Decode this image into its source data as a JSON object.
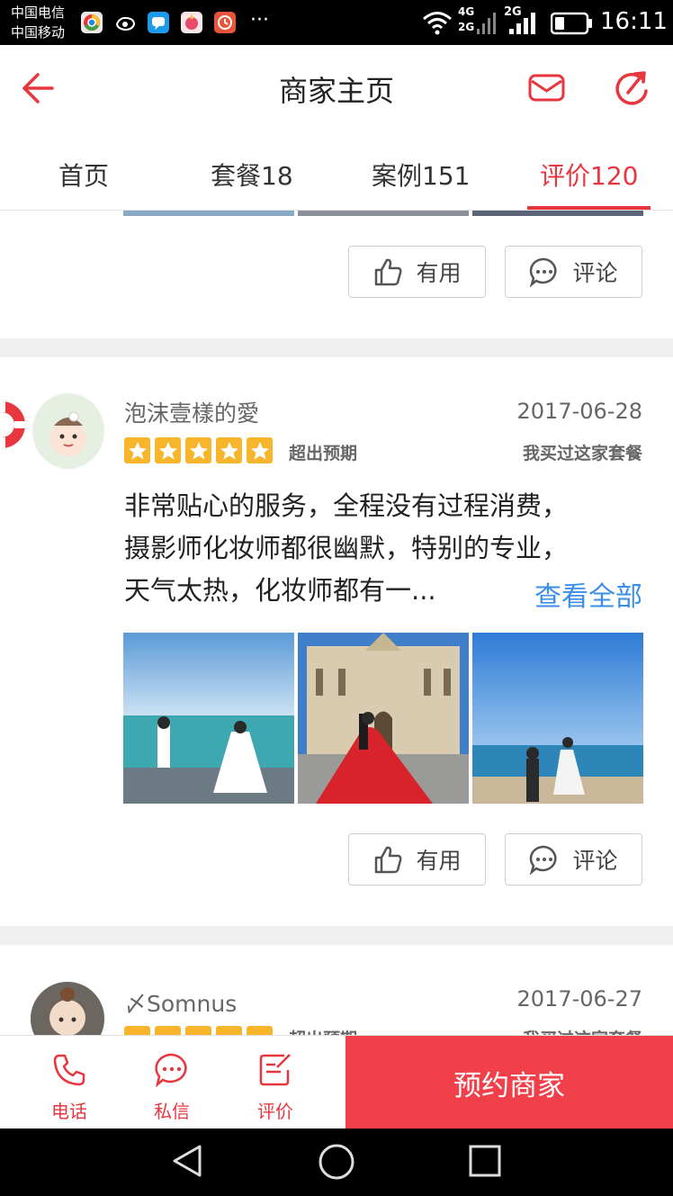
{
  "status_bar": {
    "carrier_1": "中国电信",
    "carrier_2": "中国移动",
    "overflow": "···",
    "net_1_top": "4G",
    "net_1_bottom": "2G",
    "net_2": "2G",
    "time": "16:11"
  },
  "header": {
    "title": "商家主页",
    "back_icon": "arrow-left-icon",
    "message_icon": "mail-icon",
    "share_icon": "share-icon"
  },
  "tabs": [
    {
      "label": "首页",
      "active": false
    },
    {
      "label": "套餐18",
      "active": false
    },
    {
      "label": "案例151",
      "active": false
    },
    {
      "label": "评价120",
      "active": true
    }
  ],
  "actions": {
    "useful_label": "有用",
    "comment_label": "评论"
  },
  "reviews": [
    {
      "username": "泡沫壹樣的愛",
      "date": "2017-06-28",
      "stars": 5,
      "rating_text": "超出预期",
      "purchased": "我买过这家套餐",
      "text_lines": [
        "非常贴心的服务，全程没有过程消费，",
        "摄影师化妆师都很幽默，特别的专业，",
        "天气太热，化妆师都有一..."
      ],
      "see_all": "查看全部"
    },
    {
      "username": "〆Somnus",
      "date": "2017-06-27",
      "stars": 5,
      "rating_text": "超出预期",
      "purchased": "我买过这家套餐"
    }
  ],
  "bottom_bar": {
    "phone_label": "电话",
    "message_label": "私信",
    "review_label": "评价",
    "book_label": "预约商家"
  },
  "colors": {
    "accent": "#e8363f",
    "book_button": "#f2404b",
    "star": "#f7b52c",
    "link": "#3b8ee8"
  }
}
